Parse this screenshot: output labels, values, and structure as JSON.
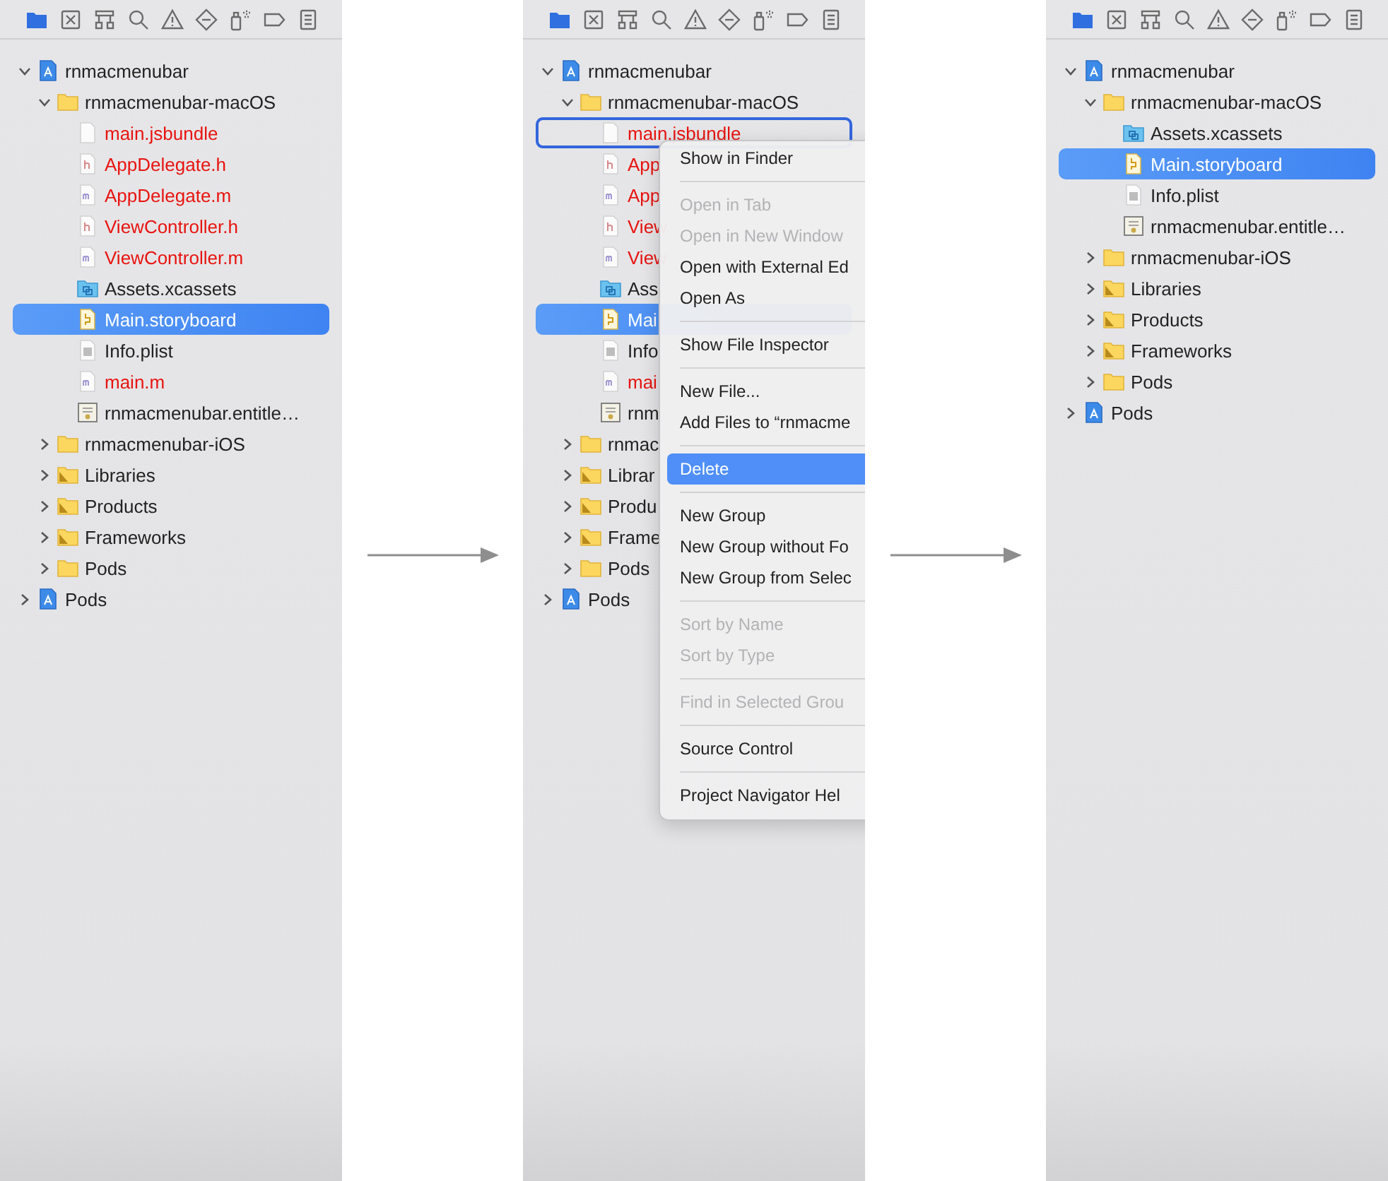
{
  "panels": [
    {
      "navigator_tabs": [
        {
          "kind": "folder",
          "selected": true
        },
        {
          "kind": "x-square",
          "selected": false
        },
        {
          "kind": "hierarchy",
          "selected": false
        },
        {
          "kind": "search",
          "selected": false
        },
        {
          "kind": "warning",
          "selected": false
        },
        {
          "kind": "diamond",
          "selected": false
        },
        {
          "kind": "spray",
          "selected": false
        },
        {
          "kind": "label",
          "selected": false
        },
        {
          "kind": "list",
          "selected": false
        }
      ],
      "tree": [
        {
          "label": "rnmacmenubar",
          "kind": "project",
          "expanded": true,
          "children": [
            {
              "label": "rnmacmenubar-macOS",
              "kind": "folder",
              "expanded": true,
              "children": [
                {
                  "label": "main.jsbundle",
                  "kind": "blank",
                  "missing": true,
                  "selected": false
                },
                {
                  "label": "AppDelegate.h",
                  "kind": "header",
                  "missing": true,
                  "selected": false
                },
                {
                  "label": "AppDelegate.m",
                  "kind": "source",
                  "missing": true,
                  "selected": false
                },
                {
                  "label": "ViewController.h",
                  "kind": "header",
                  "missing": true,
                  "selected": false
                },
                {
                  "label": "ViewController.m",
                  "kind": "source",
                  "missing": true,
                  "selected": false
                },
                {
                  "label": "Assets.xcassets",
                  "kind": "assets",
                  "missing": false,
                  "selected": false
                },
                {
                  "label": "Main.storyboard",
                  "kind": "storyboard",
                  "missing": false,
                  "selected": true
                },
                {
                  "label": "Info.plist",
                  "kind": "plist",
                  "missing": false,
                  "selected": false
                },
                {
                  "label": "main.m",
                  "kind": "source",
                  "missing": true,
                  "selected": false
                },
                {
                  "label": "rnmacmenubar.entitle…",
                  "kind": "entitlements",
                  "missing": false,
                  "selected": false
                }
              ]
            },
            {
              "label": "rnmacmenubar-iOS",
              "kind": "folder",
              "expanded": false
            },
            {
              "label": "Libraries",
              "kind": "group",
              "expanded": false
            },
            {
              "label": "Products",
              "kind": "group",
              "expanded": false
            },
            {
              "label": "Frameworks",
              "kind": "group",
              "expanded": false
            },
            {
              "label": "Pods",
              "kind": "folder",
              "expanded": false
            }
          ]
        },
        {
          "label": "Pods",
          "kind": "project",
          "expanded": false
        }
      ]
    },
    {
      "navigator_tabs": [
        {
          "kind": "folder",
          "selected": true
        },
        {
          "kind": "x-square",
          "selected": false
        },
        {
          "kind": "hierarchy",
          "selected": false
        },
        {
          "kind": "search",
          "selected": false
        },
        {
          "kind": "warning",
          "selected": false
        },
        {
          "kind": "diamond",
          "selected": false
        },
        {
          "kind": "spray",
          "selected": false
        },
        {
          "kind": "label",
          "selected": false
        },
        {
          "kind": "list",
          "selected": false
        }
      ],
      "tree": [
        {
          "label": "rnmacmenubar",
          "kind": "project",
          "expanded": true,
          "children": [
            {
              "label": "rnmacmenubar-macOS",
              "kind": "folder",
              "expanded": true,
              "children": [
                {
                  "label": "main.jsbundle",
                  "kind": "blank",
                  "missing": true,
                  "selected": false,
                  "context_target": true
                },
                {
                  "label": "App",
                  "kind": "header",
                  "missing": true,
                  "selected": false
                },
                {
                  "label": "App",
                  "kind": "source",
                  "missing": true,
                  "selected": false
                },
                {
                  "label": "View",
                  "kind": "header",
                  "missing": true,
                  "selected": false
                },
                {
                  "label": "View",
                  "kind": "source",
                  "missing": true,
                  "selected": false
                },
                {
                  "label": "Ass",
                  "kind": "assets",
                  "missing": false,
                  "selected": false
                },
                {
                  "label": "Mai",
                  "kind": "storyboard",
                  "missing": false,
                  "selected": true
                },
                {
                  "label": "Info",
                  "kind": "plist",
                  "missing": false,
                  "selected": false
                },
                {
                  "label": "mai",
                  "kind": "source",
                  "missing": true,
                  "selected": false
                },
                {
                  "label": "rnm",
                  "kind": "entitlements",
                  "missing": false,
                  "selected": false
                }
              ]
            },
            {
              "label": "rnmac",
              "kind": "folder",
              "expanded": false
            },
            {
              "label": "Librar",
              "kind": "group",
              "expanded": false
            },
            {
              "label": "Produ",
              "kind": "group",
              "expanded": false
            },
            {
              "label": "Frame",
              "kind": "group",
              "expanded": false
            },
            {
              "label": "Pods",
              "kind": "folder",
              "expanded": false
            }
          ]
        },
        {
          "label": "Pods",
          "kind": "project",
          "expanded": false
        }
      ],
      "context_menu": [
        {
          "kind": "item",
          "label": "Show in Finder",
          "disabled": false,
          "selected": false
        },
        {
          "kind": "separator"
        },
        {
          "kind": "item",
          "label": "Open in Tab",
          "disabled": true,
          "selected": false
        },
        {
          "kind": "item",
          "label": "Open in New Window",
          "disabled": true,
          "selected": false
        },
        {
          "kind": "item",
          "label": "Open with External Ed",
          "disabled": false,
          "selected": false
        },
        {
          "kind": "item",
          "label": "Open As",
          "disabled": false,
          "selected": false
        },
        {
          "kind": "separator"
        },
        {
          "kind": "item",
          "label": "Show File Inspector",
          "disabled": false,
          "selected": false
        },
        {
          "kind": "separator"
        },
        {
          "kind": "item",
          "label": "New File...",
          "disabled": false,
          "selected": false
        },
        {
          "kind": "item",
          "label": "Add Files to “rnmacme",
          "disabled": false,
          "selected": false
        },
        {
          "kind": "separator"
        },
        {
          "kind": "item",
          "label": "Delete",
          "disabled": false,
          "selected": true
        },
        {
          "kind": "separator"
        },
        {
          "kind": "item",
          "label": "New Group",
          "disabled": false,
          "selected": false
        },
        {
          "kind": "item",
          "label": "New Group without Fo",
          "disabled": false,
          "selected": false
        },
        {
          "kind": "item",
          "label": "New Group from Selec",
          "disabled": false,
          "selected": false
        },
        {
          "kind": "separator"
        },
        {
          "kind": "item",
          "label": "Sort by Name",
          "disabled": true,
          "selected": false
        },
        {
          "kind": "item",
          "label": "Sort by Type",
          "disabled": true,
          "selected": false
        },
        {
          "kind": "separator"
        },
        {
          "kind": "item",
          "label": "Find in Selected Grou",
          "disabled": true,
          "selected": false
        },
        {
          "kind": "separator"
        },
        {
          "kind": "item",
          "label": "Source Control",
          "disabled": false,
          "selected": false
        },
        {
          "kind": "separator"
        },
        {
          "kind": "item",
          "label": "Project Navigator Hel",
          "disabled": false,
          "selected": false
        }
      ]
    },
    {
      "navigator_tabs": [
        {
          "kind": "folder",
          "selected": true
        },
        {
          "kind": "x-square",
          "selected": false
        },
        {
          "kind": "hierarchy",
          "selected": false
        },
        {
          "kind": "search",
          "selected": false
        },
        {
          "kind": "warning",
          "selected": false
        },
        {
          "kind": "diamond",
          "selected": false
        },
        {
          "kind": "spray",
          "selected": false
        },
        {
          "kind": "label",
          "selected": false
        },
        {
          "kind": "list",
          "selected": false
        }
      ],
      "tree": [
        {
          "label": "rnmacmenubar",
          "kind": "project",
          "expanded": true,
          "children": [
            {
              "label": "rnmacmenubar-macOS",
              "kind": "folder",
              "expanded": true,
              "children": [
                {
                  "label": "Assets.xcassets",
                  "kind": "assets",
                  "missing": false,
                  "selected": false
                },
                {
                  "label": "Main.storyboard",
                  "kind": "storyboard",
                  "missing": false,
                  "selected": true
                },
                {
                  "label": "Info.plist",
                  "kind": "plist",
                  "missing": false,
                  "selected": false
                },
                {
                  "label": "rnmacmenubar.entitle…",
                  "kind": "entitlements",
                  "missing": false,
                  "selected": false
                }
              ]
            },
            {
              "label": "rnmacmenubar-iOS",
              "kind": "folder",
              "expanded": false
            },
            {
              "label": "Libraries",
              "kind": "group",
              "expanded": false
            },
            {
              "label": "Products",
              "kind": "group",
              "expanded": false
            },
            {
              "label": "Frameworks",
              "kind": "group",
              "expanded": false
            },
            {
              "label": "Pods",
              "kind": "folder",
              "expanded": false
            }
          ]
        },
        {
          "label": "Pods",
          "kind": "project",
          "expanded": false
        }
      ]
    }
  ]
}
